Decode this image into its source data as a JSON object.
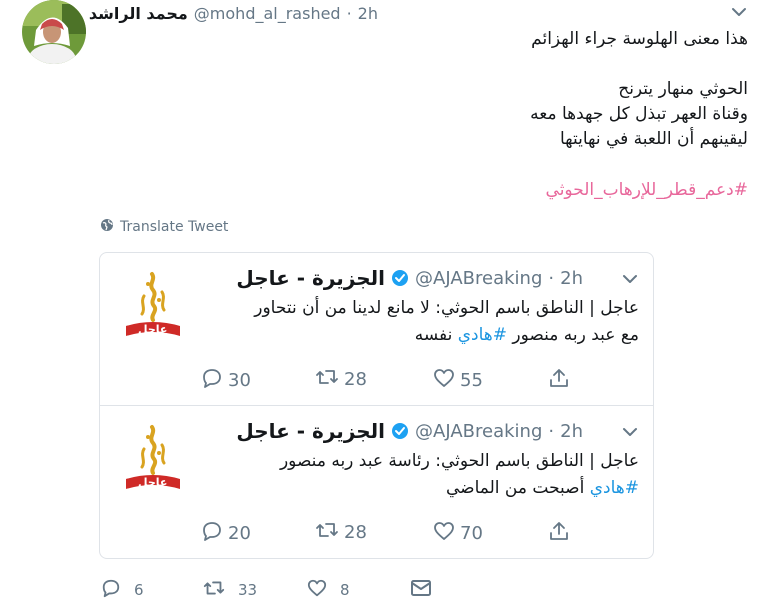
{
  "tweet": {
    "author_name": "محمد الراشد",
    "handle": "@mohd_al_rashed",
    "dot": "·",
    "time": "2h",
    "lines": [
      "هذا معنى الهلوسة جراء الهزائم",
      "",
      "الحوثي منهار يترنح",
      "وقناة العهر تبذل كل جهدها معه",
      "ليقينهم أن اللعبة في نهايتها"
    ],
    "hashtag": "#دعم_قطر_للإرهاب_الحوثي",
    "translate_label": "Translate Tweet",
    "actions": {
      "reply_count": "6",
      "retweet_count": "33",
      "like_count": "8"
    }
  },
  "quoted": [
    {
      "name": "الجزيرة - عاجل",
      "handle": "@AJABreaking",
      "dot": "·",
      "time": "2h",
      "text_line1": "عاجل | الناطق باسم الحوثي: لا مانع لدينا من أن نتحاور",
      "text_line2_pre": "مع عبد ربه منصور ",
      "text_line2_hashtag": "#هادي",
      "text_line2_post": " نفسه",
      "reply_count": "30",
      "retweet_count": "28",
      "like_count": "55",
      "logo_text": "عاجل"
    },
    {
      "name": "الجزيرة - عاجل",
      "handle": "@AJABreaking",
      "dot": "·",
      "time": "2h",
      "text_line1": "عاجل | الناطق باسم الحوثي: رئاسة عبد ربه منصور",
      "text_line2_pre": "",
      "text_line2_hashtag": "#هادي",
      "text_line2_post": " أصبحت من الماضي",
      "reply_count": "20",
      "retweet_count": "28",
      "like_count": "70",
      "logo_text": "عاجل"
    }
  ],
  "colors": {
    "hashtag_main": "#e8679b",
    "hashtag_quote": "#1b95e0",
    "verified": "#1da1f2",
    "secondary_text": "#657786",
    "logo_gold": "#d9a320",
    "logo_red": "#cf2a27"
  },
  "icons": [
    "caret-down-icon",
    "globe-icon",
    "verified-badge-icon",
    "reply-icon",
    "retweet-icon",
    "like-icon",
    "share-icon",
    "dm-icon"
  ]
}
